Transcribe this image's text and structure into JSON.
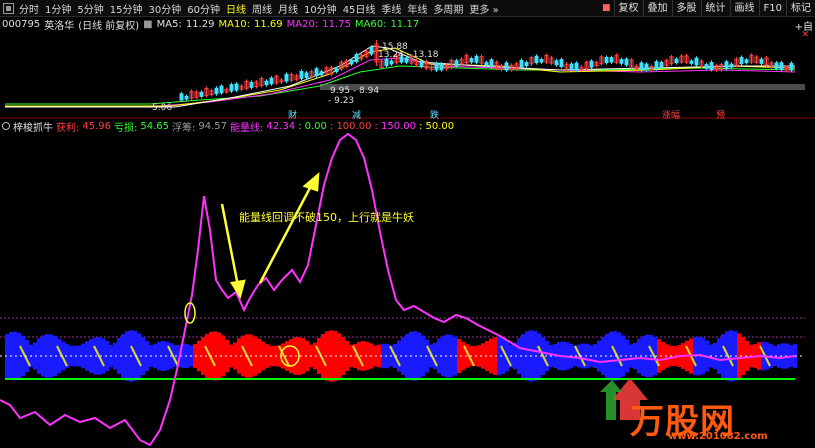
{
  "toolbar": {
    "periods": [
      "分时",
      "1分钟",
      "5分钟",
      "15分钟",
      "30分钟",
      "60分钟",
      "日线",
      "周线",
      "月线",
      "10分钟",
      "45日线",
      "季线",
      "年线",
      "多周期",
      "更多 »"
    ],
    "active_period": "日线",
    "right_buttons": [
      "复权",
      "叠加",
      "多股",
      "统计",
      "画线",
      "F10",
      "标记"
    ],
    "right_extra": "+自"
  },
  "info": {
    "code": "000795",
    "name": "英洛华",
    "mode": "(日线 前复权)",
    "ma5_label": "MA5:",
    "ma5": "11.29",
    "ma10_label": "MA10:",
    "ma10": "11.69",
    "ma20_label": "MA20:",
    "ma20": "11.75",
    "ma60_label": "MA60:",
    "ma60": "11.17"
  },
  "price_labels": {
    "high": "15.88",
    "high2": "13.24",
    "high3": "13.18",
    "low": "5.06",
    "mid1": "9.95",
    "mid2": "8.94",
    "mid3": "9.23"
  },
  "event_marks": [
    "财",
    "减",
    "跌",
    "涨幅",
    "预"
  ],
  "indicator": {
    "name": "梓梭抓牛",
    "profit_label": "获利:",
    "profit": "45.96",
    "loss_label": "亏损:",
    "loss": "54.65",
    "float_label": "浮筹:",
    "float": "94.57",
    "energy_label": "能量线:",
    "energy": "42.34",
    "levels": [
      ": 0.00",
      ": 100.00",
      ": 150.00",
      ": 50.00"
    ]
  },
  "annotation": "能量线回调不破150，上行就是牛妖",
  "logo": {
    "brand": "万股网",
    "url": "www.201082.com"
  },
  "colors": {
    "energy_line": "#ff33ff",
    "band_red": "#ff0000",
    "band_blue": "#1a1aff",
    "zero_line": "#00ff00",
    "annotation": "#ffff33"
  }
}
